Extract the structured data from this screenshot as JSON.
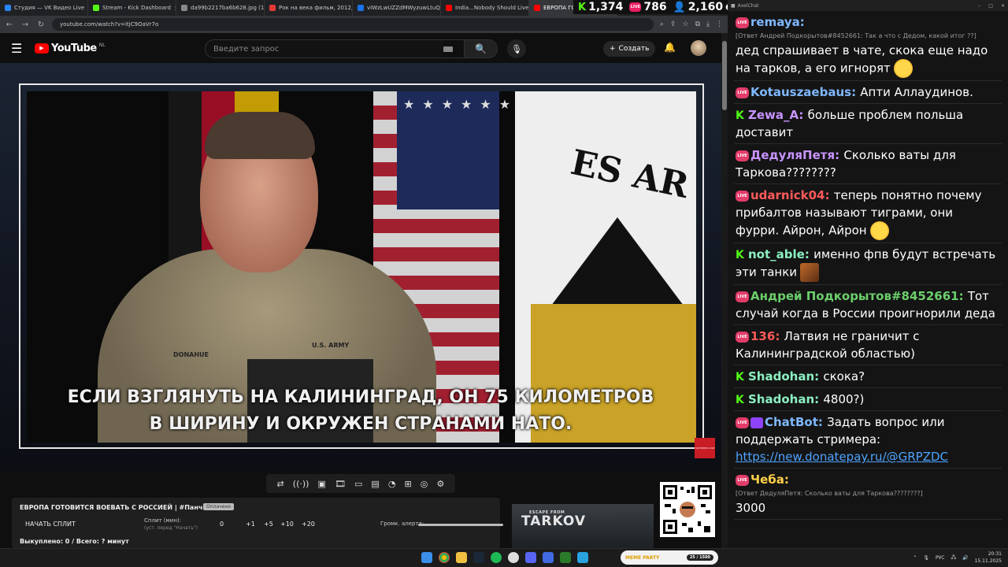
{
  "browser": {
    "tabs": [
      {
        "label": "Студия — VK Видео Live",
        "color": "#2787f5"
      },
      {
        "label": "Stream - Kick Dashboard",
        "color": "#53fc18"
      },
      {
        "label": "da99b2217ba6b628.jpg (13...",
        "color": "#888888"
      },
      {
        "label": "Рок на века фильм, 2012, д...",
        "color": "#e53935"
      },
      {
        "label": "vIWzLwUZZdMWyzuwLtuQs...",
        "color": "#1a73e8"
      },
      {
        "label": "India...Nobody Should Live I...",
        "color": "#ff0000"
      },
      {
        "label": "ЕВРОПА ГОТОВИТСЯ ВОЕВ...",
        "color": "#ff0000"
      }
    ],
    "url": "youtube.com/watch?v=itjC9OaVr7o"
  },
  "stats": {
    "kick_viewers": "1,374",
    "live_viewers": "786",
    "total_viewers": "2,160",
    "total_suffix": "о"
  },
  "youtube": {
    "logo_text": "YouTube",
    "region": "NL",
    "search_placeholder": "Введите запрос",
    "create_label": "Создать",
    "subtitle_line1": "ЕСЛИ ВЗГЛЯНУТЬ НА КАЛИНИНГРАД, ОН 75 КИЛОМЕТРОВ",
    "subtitle_line2": "В ШИРИНУ И ОКРУЖЕН СТРАНАМИ НАТО.",
    "flag_text": "ES AR",
    "channel_logo_text": "ПАНЧЕНКО LIVE",
    "name_tape": "DONAHUE",
    "army_tape": "U.S. ARMY"
  },
  "panel": {
    "title": "ЕВРОПА ГОТОВИТСЯ ВОЕВАТЬ С РОССИЕЙ | #Панченко",
    "tag": "Оплачено",
    "split_button": "НАЧАТЬ СПЛИТ",
    "split_label": "Сплит (мин):",
    "split_hint": "(уст. перед \"Начать\")",
    "split_value": "0",
    "increments": [
      "+1",
      "+5",
      "+10",
      "+20"
    ],
    "volume_label": "Громк. алерта:",
    "bought": "Выкуплено: 0 / Всего: ? минут"
  },
  "tarkov": {
    "escape_from": "ESCAPE FROM",
    "word": "TARKOV"
  },
  "taskbar": {
    "meme_party_title": "MEME PARTY",
    "meme_party_progress": "25 / 1500",
    "lang": "РУС",
    "time": "20:31",
    "date": "15.11.2025"
  },
  "chat_window_title": "AxelChat",
  "chat": [
    {
      "source": "live",
      "user": "remaya",
      "color": "#7fb8ff",
      "reply": "[Ответ Андрей Подкорытов#8452661: Так а что с Дедом, какой итог ??]",
      "text": "дед спрашивает в чате, скока еще надо на тарков, а его игнорят",
      "emote": "tongue"
    },
    {
      "source": "live",
      "user": "Kotauszaebaus",
      "color": "#7fb8ff",
      "reply": "",
      "text": "Апти Аллаудинов.",
      "emote": ""
    },
    {
      "source": "kick",
      "user": "Zewa_A",
      "color": "#c894ff",
      "reply": "",
      "text": "больше проблем польша доставит",
      "emote": ""
    },
    {
      "source": "live",
      "user": "ДедуляПетя",
      "color": "#c894ff",
      "reply": "",
      "text": "Сколько ваты для Таркова????????",
      "emote": ""
    },
    {
      "source": "live",
      "user": "udarnick04",
      "color": "#ff5a5a",
      "reply": "",
      "text": "теперь понятно почему прибалтов называют тиграми, они фурри. Айрон, Айрон",
      "emote": "tongue"
    },
    {
      "source": "kick",
      "user": "not_able",
      "color": "#8cf0c0",
      "reply": "",
      "text": "именно фпв будут встречать эти танки",
      "emote": "doge"
    },
    {
      "source": "live",
      "user": "Андрей Подкорытов#8452661",
      "color": "#6ccf6c",
      "reply": "",
      "text": "Тот случай когда в России проигнорили деда",
      "emote": ""
    },
    {
      "source": "live",
      "user": "136",
      "color": "#ff5a5a",
      "reply": "",
      "text": "Латвия не граничит с Калининградской областью)",
      "emote": ""
    },
    {
      "source": "kick",
      "user": "Shadohan",
      "color": "#8cf0c0",
      "reply": "",
      "text": "скока?",
      "emote": ""
    },
    {
      "source": "kick",
      "user": "Shadohan",
      "color": "#8cf0c0",
      "reply": "",
      "text": "4800?)",
      "emote": ""
    },
    {
      "source": "live",
      "user": "ChatBot",
      "color": "#7fb8ff",
      "reply": "",
      "text": "Задать вопрос или поддержать стримера:",
      "link": "https://new.donatepay.ru/@GRPZDC",
      "emote": ""
    },
    {
      "source": "live",
      "user": "Чеба",
      "color": "#ffd04a",
      "reply": "[Ответ ДедуляПетя: Сколько ваты для Таркова????????]",
      "text": "3000",
      "emote": ""
    }
  ]
}
